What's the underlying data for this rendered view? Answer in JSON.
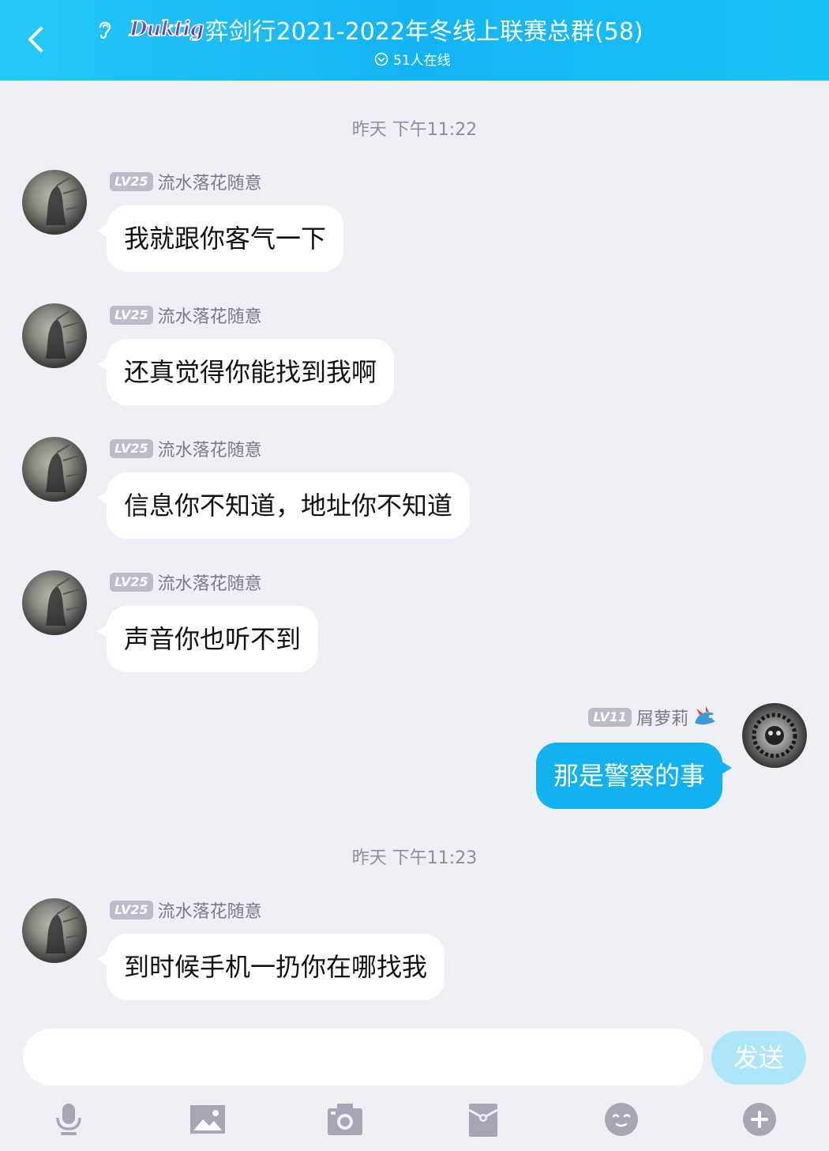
{
  "header": {
    "logo_text": "Duktig",
    "title": "弈剑行2021-2022年冬线上联赛总群(58)",
    "online": "51人在线"
  },
  "timestamps": [
    "昨天 下午11:22",
    "昨天 下午11:23"
  ],
  "other_user": {
    "level": "LV25",
    "nickname": "流水落花随意"
  },
  "me": {
    "level": "LV11",
    "nickname": "屑萝莉"
  },
  "messages": [
    {
      "from": "other",
      "text": "我就跟你客气一下"
    },
    {
      "from": "other",
      "text": "还真觉得你能找到我啊"
    },
    {
      "from": "other",
      "text": "信息你不知道，地址你不知道"
    },
    {
      "from": "other",
      "text": "声音你也听不到"
    },
    {
      "from": "me",
      "text": "那是警察的事"
    },
    {
      "from": "other",
      "text": "到时候手机一扔你在哪找我"
    }
  ],
  "input": {
    "value": "",
    "send_label": "发送"
  },
  "toolbar_icons": [
    "microphone-icon",
    "image-icon",
    "camera-icon",
    "red-packet-icon",
    "emoji-icon",
    "plus-icon"
  ],
  "colors": {
    "header": "#14b4f4",
    "bubble_me": "#12b2f1",
    "background": "#eef0f6",
    "send_disabled": "#aee6f9"
  }
}
